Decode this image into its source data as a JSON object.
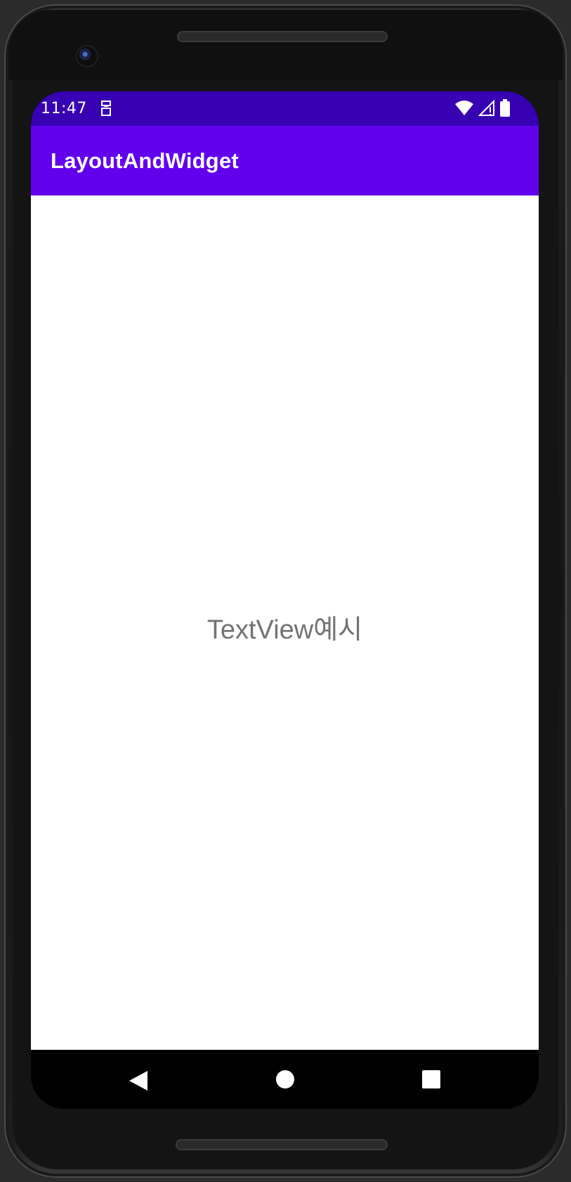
{
  "status_bar": {
    "time": "11:47",
    "color": "#3700b3",
    "icons": [
      "sim-card-icon",
      "wifi-icon",
      "cell-signal-icon",
      "battery-icon"
    ]
  },
  "app_bar": {
    "title": "LayoutAndWidget",
    "color": "#6200ee"
  },
  "content": {
    "text_view": "TextView예시"
  },
  "nav_bar": {
    "buttons": [
      "back-icon",
      "home-icon",
      "recents-icon"
    ]
  }
}
